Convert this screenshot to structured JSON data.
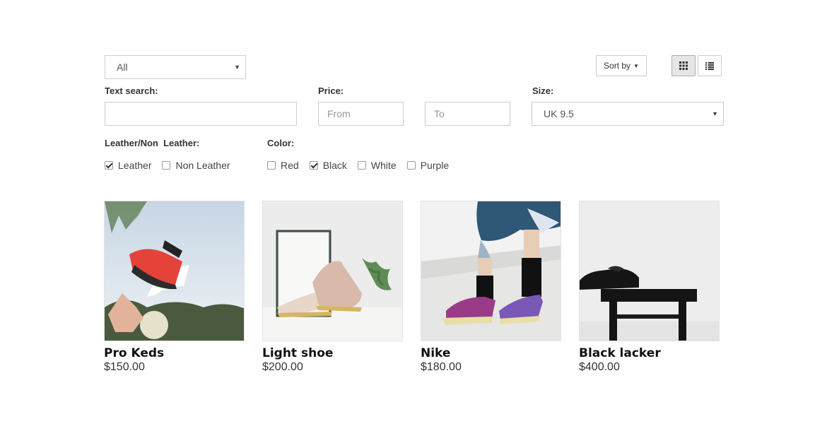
{
  "filters": {
    "category": {
      "selected": "All"
    },
    "sort_label": "Sort by",
    "text_search": {
      "label": "Text search:",
      "value": ""
    },
    "price": {
      "label": "Price:",
      "from_placeholder": "From",
      "to_placeholder": "To"
    },
    "size": {
      "label": "Size:",
      "selected": "UK 9.5"
    },
    "leather": {
      "label": "Leather/Non  Leather:",
      "options": [
        {
          "label": "Leather",
          "checked": true
        },
        {
          "label": "Non Leather",
          "checked": false
        }
      ]
    },
    "color": {
      "label": "Color:",
      "options": [
        {
          "label": "Red",
          "checked": false
        },
        {
          "label": "Black",
          "checked": true
        },
        {
          "label": "White",
          "checked": false
        },
        {
          "label": "Purple",
          "checked": false
        }
      ]
    }
  },
  "view": {
    "active": "grid"
  },
  "icons": {
    "grid": "grid-icon",
    "list": "list-icon",
    "caret": "caret-down-icon",
    "checked": "checkmark-icon"
  },
  "products": [
    {
      "name": "Pro Keds",
      "price": "$150.00"
    },
    {
      "name": "Light shoe",
      "price": "$200.00"
    },
    {
      "name": "Nike",
      "price": "$180.00"
    },
    {
      "name": "Black lacker",
      "price": "$400.00"
    }
  ]
}
